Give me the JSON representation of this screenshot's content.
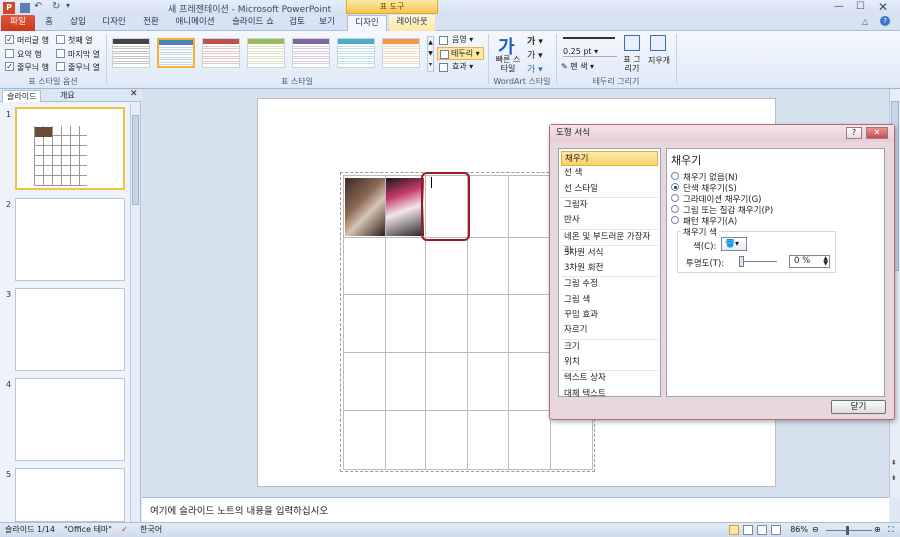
{
  "window": {
    "title": "새 프레젠테이션 - Microsoft PowerPoint",
    "context_tab_group": "표 도구"
  },
  "tabs": [
    {
      "label": "파일",
      "kind": "file"
    },
    {
      "label": "홈"
    },
    {
      "label": "삽입"
    },
    {
      "label": "디자인"
    },
    {
      "label": "전환"
    },
    {
      "label": "애니메이션"
    },
    {
      "label": "슬라이드 쇼"
    },
    {
      "label": "검토"
    },
    {
      "label": "보기"
    },
    {
      "label": "디자인",
      "kind": "active"
    },
    {
      "label": "레이아웃",
      "kind": "ctx"
    }
  ],
  "ribbon": {
    "style_options": {
      "label": "표 스타일 옵션",
      "items": [
        {
          "label": "머리글 행",
          "checked": true
        },
        {
          "label": "첫째 열",
          "checked": false
        },
        {
          "label": "요약 행",
          "checked": false
        },
        {
          "label": "마지막 열",
          "checked": false
        },
        {
          "label": "줄무늬 행",
          "checked": true
        },
        {
          "label": "줄무늬 열",
          "checked": false
        }
      ]
    },
    "table_styles": {
      "label": "표 스타일",
      "swatch_colors": [
        "#444444",
        "#4f81bd",
        "#c0504d",
        "#9bbb59",
        "#8064a2",
        "#4bacc6",
        "#f79646"
      ],
      "shading": "음영",
      "borders": "테두리",
      "effects": "효과"
    },
    "wordart": {
      "label": "WordArt 스타일",
      "quick_styles": "빠른 스타일"
    },
    "draw_borders": {
      "label": "테두리 그리기",
      "pen_weight": "0.25 pt",
      "pen_color": "펜 색",
      "draw_table": "표 그리기",
      "eraser": "지우개"
    }
  },
  "slides_panel": {
    "tabs": [
      "슬라이드",
      "개요"
    ],
    "numbers": [
      "1",
      "2",
      "3",
      "4",
      "5"
    ]
  },
  "notes_placeholder": "여기에 슬라이드 노트의 내용을 입력하십시오",
  "status": {
    "slide": "슬라이드 1/14",
    "theme": "\"Office 테마\"",
    "language": "한국어",
    "zoom": "86%"
  },
  "dialog": {
    "title": "도형 서식",
    "categories": [
      "채우기",
      "선 색",
      "선 스타일",
      "그림자",
      "반사",
      "네온 및 부드러운 가장자리",
      "3차원 서식",
      "3차원 회전",
      "그림 수정",
      "그림 색",
      "꾸밈 효과",
      "자르기",
      "크기",
      "위치",
      "텍스트 상자",
      "대체 텍스트"
    ],
    "section_title": "채우기",
    "fill_options": [
      "채우기 없음(N)",
      "단색 채우기(S)",
      "그라데이션 채우기(G)",
      "그림 또는 질감 채우기(P)",
      "패턴 채우기(A)"
    ],
    "fill_color_group": "채우기 색",
    "color_label": "색(C):",
    "transparency_label": "투명도(T):",
    "transparency_value": "0 %",
    "close_label": "닫기"
  }
}
